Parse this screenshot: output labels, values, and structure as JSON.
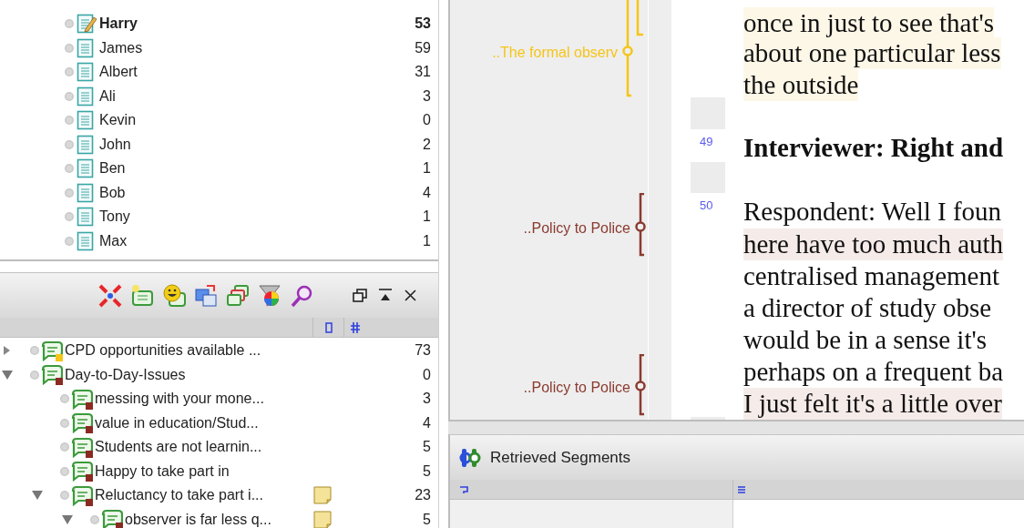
{
  "documents": [
    {
      "label": "Harry",
      "count": "53",
      "active": true
    },
    {
      "label": "James",
      "count": "59",
      "active": false
    },
    {
      "label": "Albert",
      "count": "31",
      "active": false
    },
    {
      "label": "Ali",
      "count": "3",
      "active": false
    },
    {
      "label": "Kevin",
      "count": "0",
      "active": false
    },
    {
      "label": "John",
      "count": "2",
      "active": false
    },
    {
      "label": "Ben",
      "count": "1",
      "active": false
    },
    {
      "label": "Bob",
      "count": "4",
      "active": false
    },
    {
      "label": "Tony",
      "count": "1",
      "active": false
    },
    {
      "label": "Max",
      "count": "1",
      "active": false
    }
  ],
  "code_system": {
    "codes": [
      {
        "label": "CPD opportunities available ...",
        "count": "73",
        "color": "#f5c518",
        "expanded": false,
        "memo": false
      },
      {
        "label": "Day-to-Day-Issues",
        "count": "0",
        "color": "#8b2a22",
        "expanded": true,
        "memo": false,
        "children": [
          {
            "label": "messing with your mone...",
            "count": "3",
            "color": "#8b2a22",
            "memo": false
          },
          {
            "label": "value in education/Stud...",
            "count": "4",
            "color": "#8b2a22",
            "memo": false
          },
          {
            "label": "Students are not learnin...",
            "count": "5",
            "color": "#8b2a22",
            "memo": false
          },
          {
            "label": "Happy to take part in",
            "count": "5",
            "color": "#8b2a22",
            "memo": false
          },
          {
            "label": "Reluctancy to take part i...",
            "count": "23",
            "color": "#8b2a22",
            "expanded": true,
            "memo": true,
            "children": [
              {
                "label": "observer is far less q...",
                "count": "5",
                "color": "#8b2a22",
                "expanded": true,
                "memo": true
              }
            ]
          }
        ]
      }
    ]
  },
  "margin_codes": [
    {
      "label": "..The formal observ",
      "color": "#f5c518"
    },
    {
      "label": "..Policy to Police",
      "color": "#8b3a2f"
    },
    {
      "label": "..Policy to Police",
      "color": "#8b3a2f"
    }
  ],
  "document_lines": [
    {
      "text": "once in just to see that's",
      "color": "#fdf7e8"
    },
    {
      "text": "about one particular less",
      "color": "#fdf7e8"
    },
    {
      "text": "the outside",
      "color": "#fdf7e8"
    },
    {
      "number": "49",
      "text": "Interviewer:  Right and",
      "bold": true
    },
    {
      "number": "50",
      "text": "Respondent: Well I foun"
    },
    {
      "text": "here have too much auth",
      "color": "#f5ebe9"
    },
    {
      "text": "centralised management"
    },
    {
      "text": "a director of study obse"
    },
    {
      "text": "would be in a sense it's"
    },
    {
      "text": "perhaps on a frequent ba"
    },
    {
      "text": "I just felt it's a little over",
      "color": "#f5ebe9"
    }
  ],
  "retrieved_segments": {
    "title": "Retrieved Segments"
  }
}
